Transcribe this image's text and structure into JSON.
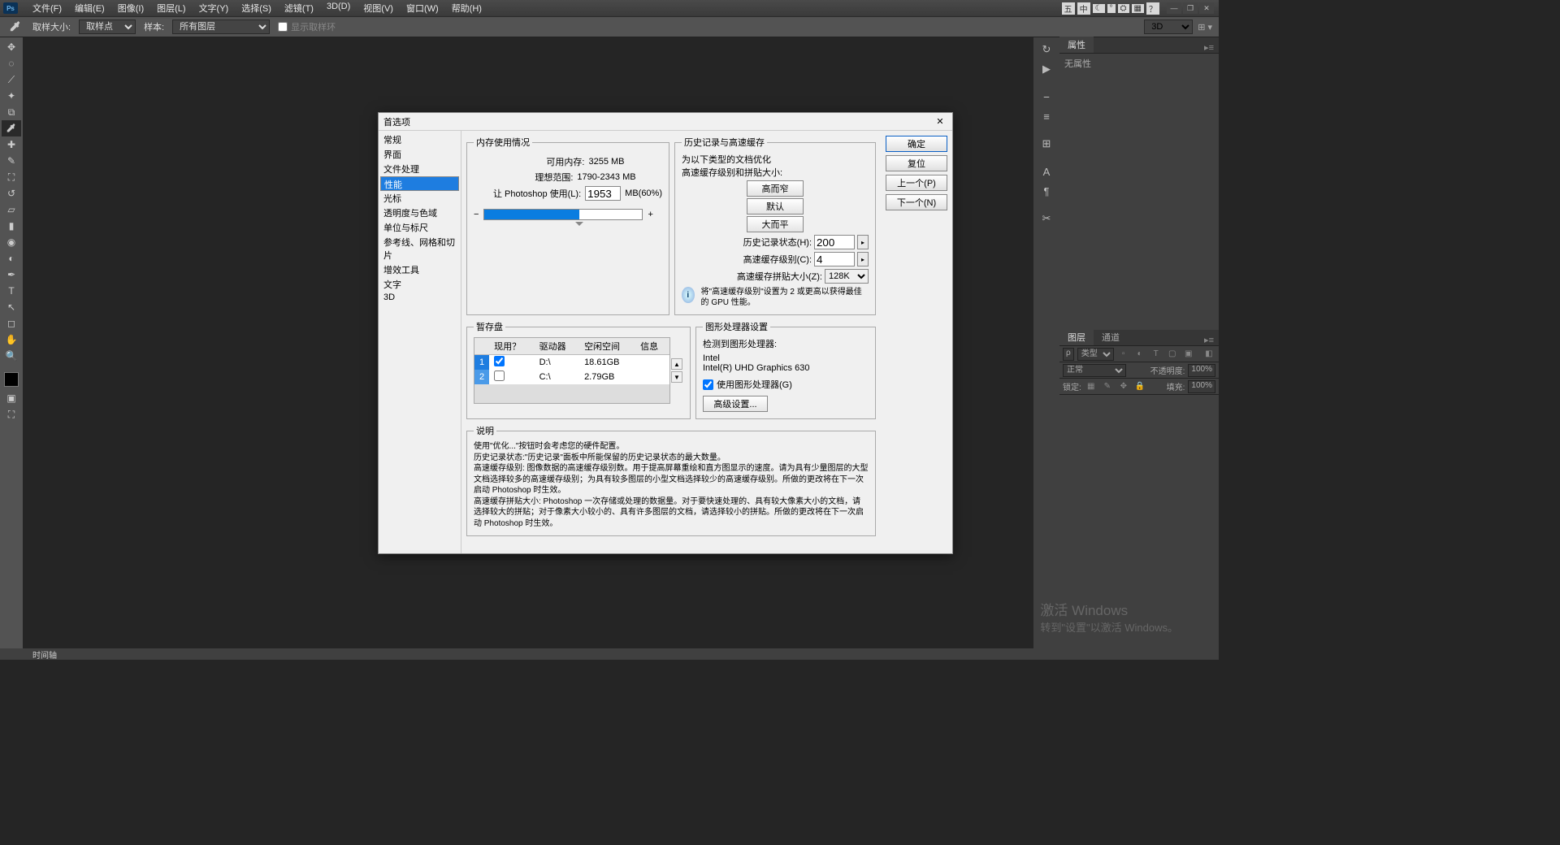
{
  "menubar": {
    "items": [
      "文件(F)",
      "编辑(E)",
      "图像(I)",
      "图层(L)",
      "文字(Y)",
      "选择(S)",
      "滤镜(T)",
      "3D(D)",
      "视图(V)",
      "窗口(W)",
      "帮助(H)"
    ]
  },
  "ime": {
    "k": "五",
    "zh": "中",
    "moon": "☾",
    "deg": "°",
    "p": "⚙",
    "grid": "▦",
    "q": "？"
  },
  "optbar": {
    "sample_size_lbl": "取样大小:",
    "sample_size_val": "取样点",
    "sample_lbl": "样本:",
    "sample_val": "所有图层",
    "show_ring_lbl": "显示取样环",
    "mode3d": "3D"
  },
  "panels": {
    "props_tab": "属性",
    "props_none": "无属性",
    "layers_tab": "图层",
    "channels_tab": "通道",
    "kind_lbl": "类型",
    "mode_lbl": "正常",
    "opacity_lbl": "不透明度:",
    "opacity_val": "100%",
    "lock_lbl": "锁定:",
    "fill_lbl": "填充:",
    "fill_val": "100%"
  },
  "status": {
    "tl": "时间轴"
  },
  "watermark": {
    "l1": "激活 Windows",
    "l2": "转到\"设置\"以激活 Windows。"
  },
  "dialog": {
    "title": "首选项",
    "close": "✕",
    "cats": [
      "常规",
      "界面",
      "文件处理",
      "性能",
      "光标",
      "透明度与色域",
      "单位与标尺",
      "参考线、网格和切片",
      "增效工具",
      "文字",
      "3D"
    ],
    "cat_selected": 3,
    "btns": {
      "ok": "确定",
      "reset": "复位",
      "prev": "上一个(P)",
      "next": "下一个(N)"
    },
    "mem": {
      "legend": "内存使用情况",
      "avail_lbl": "可用内存:",
      "avail_val": "3255 MB",
      "ideal_lbl": "理想范围:",
      "ideal_val": "1790-2343 MB",
      "let_lbl": "让 Photoshop 使用(L):",
      "let_val": "1953",
      "let_unit": "MB(60%)"
    },
    "hist": {
      "legend": "历史记录与高速缓存",
      "hint1": "为以下类型的文档优化",
      "hint2": "高速缓存级别和拼贴大小:",
      "btn_tall": "高而窄",
      "btn_def": "默认",
      "btn_wide": "大而平",
      "states_lbl": "历史记录状态(H):",
      "states_val": "200",
      "levels_lbl": "高速缓存级别(C):",
      "levels_val": "4",
      "tile_lbl": "高速缓存拼贴大小(Z):",
      "tile_val": "128K",
      "info": "将\"高速缓存级别\"设置为 2 或更高以获得最佳的 GPU 性能。"
    },
    "scratch": {
      "legend": "暂存盘",
      "h1": "现用？",
      "h2": "驱动器",
      "h3": "空闲空间",
      "h4": "信息",
      "rows": [
        {
          "n": "1",
          "active": true,
          "drv": "D:\\",
          "free": "18.61GB"
        },
        {
          "n": "2",
          "active": false,
          "drv": "C:\\",
          "free": "2.79GB"
        }
      ]
    },
    "gpu": {
      "legend": "图形处理器设置",
      "det_lbl": "检测到图形处理器:",
      "vendor": "Intel",
      "model": "Intel(R) UHD Graphics 630",
      "use_lbl": "使用图形处理器(G)",
      "adv_btn": "高级设置..."
    },
    "desc": {
      "legend": "说明",
      "t1": "使用\"优化...\"按钮时会考虑您的硬件配置。",
      "t2": "历史记录状态:\"历史记录\"面板中所能保留的历史记录状态的最大数量。",
      "t3": "高速缓存级别: 图像数据的高速缓存级别数。用于提高屏幕重绘和直方图显示的速度。请为具有少量图层的大型文档选择较多的高速缓存级别；为具有较多图层的小型文档选择较少的高速缓存级别。所做的更改将在下一次启动 Photoshop 时生效。",
      "t4": "高速缓存拼贴大小: Photoshop 一次存储或处理的数据量。对于要快速处理的、具有较大像素大小的文档，请选择较大的拼贴；对于像素大小较小的、具有许多图层的文档，请选择较小的拼贴。所做的更改将在下一次启动 Photoshop 时生效。"
    }
  }
}
